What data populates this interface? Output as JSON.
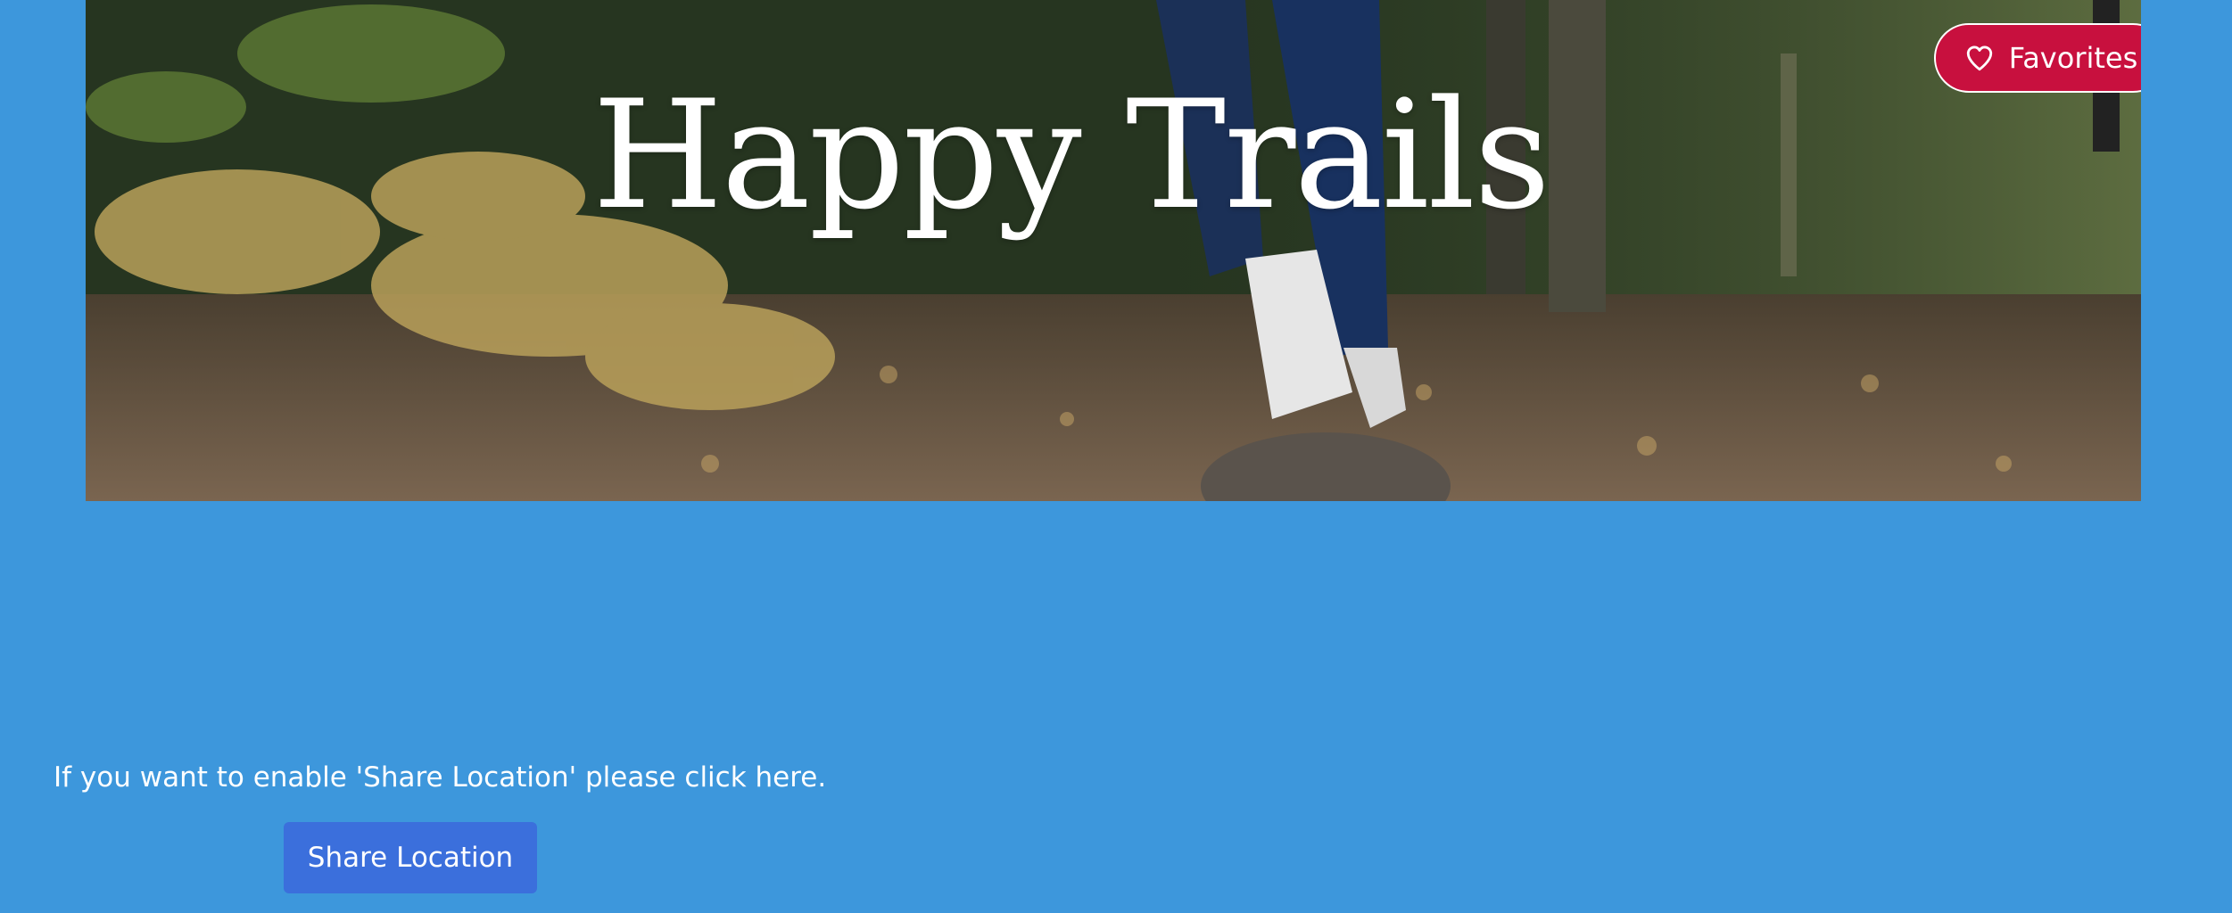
{
  "hero": {
    "title": "Happy Trails",
    "image_subject": "forest-trail-walker-photo"
  },
  "favorites_button": {
    "label": "Favorites",
    "icon": "heart-outline-icon",
    "color": "#c8103e"
  },
  "share_location": {
    "prompt_text": "If you want to enable 'Share Location' please click here.",
    "button_label": "Share Location",
    "button_color": "#3b6fdc"
  },
  "theme": {
    "background": "#3d97dc"
  }
}
